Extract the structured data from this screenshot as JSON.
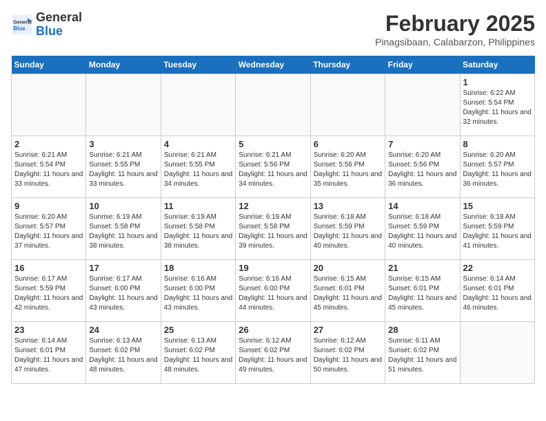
{
  "header": {
    "logo_line1": "General",
    "logo_line2": "Blue",
    "month_title": "February 2025",
    "location": "Pinagsibaan, Calabarzon, Philippines"
  },
  "days_of_week": [
    "Sunday",
    "Monday",
    "Tuesday",
    "Wednesday",
    "Thursday",
    "Friday",
    "Saturday"
  ],
  "weeks": [
    [
      {
        "day": "",
        "info": ""
      },
      {
        "day": "",
        "info": ""
      },
      {
        "day": "",
        "info": ""
      },
      {
        "day": "",
        "info": ""
      },
      {
        "day": "",
        "info": ""
      },
      {
        "day": "",
        "info": ""
      },
      {
        "day": "1",
        "info": "Sunrise: 6:22 AM\nSunset: 5:54 PM\nDaylight: 11 hours and 32 minutes."
      }
    ],
    [
      {
        "day": "2",
        "info": "Sunrise: 6:21 AM\nSunset: 5:54 PM\nDaylight: 11 hours and 33 minutes."
      },
      {
        "day": "3",
        "info": "Sunrise: 6:21 AM\nSunset: 5:55 PM\nDaylight: 11 hours and 33 minutes."
      },
      {
        "day": "4",
        "info": "Sunrise: 6:21 AM\nSunset: 5:55 PM\nDaylight: 11 hours and 34 minutes."
      },
      {
        "day": "5",
        "info": "Sunrise: 6:21 AM\nSunset: 5:56 PM\nDaylight: 11 hours and 34 minutes."
      },
      {
        "day": "6",
        "info": "Sunrise: 6:20 AM\nSunset: 5:56 PM\nDaylight: 11 hours and 35 minutes."
      },
      {
        "day": "7",
        "info": "Sunrise: 6:20 AM\nSunset: 5:56 PM\nDaylight: 11 hours and 36 minutes."
      },
      {
        "day": "8",
        "info": "Sunrise: 6:20 AM\nSunset: 5:57 PM\nDaylight: 11 hours and 36 minutes."
      }
    ],
    [
      {
        "day": "9",
        "info": "Sunrise: 6:20 AM\nSunset: 5:57 PM\nDaylight: 11 hours and 37 minutes."
      },
      {
        "day": "10",
        "info": "Sunrise: 6:19 AM\nSunset: 5:58 PM\nDaylight: 11 hours and 38 minutes."
      },
      {
        "day": "11",
        "info": "Sunrise: 6:19 AM\nSunset: 5:58 PM\nDaylight: 11 hours and 38 minutes."
      },
      {
        "day": "12",
        "info": "Sunrise: 6:19 AM\nSunset: 5:58 PM\nDaylight: 11 hours and 39 minutes."
      },
      {
        "day": "13",
        "info": "Sunrise: 6:18 AM\nSunset: 5:59 PM\nDaylight: 11 hours and 40 minutes."
      },
      {
        "day": "14",
        "info": "Sunrise: 6:18 AM\nSunset: 5:59 PM\nDaylight: 11 hours and 40 minutes."
      },
      {
        "day": "15",
        "info": "Sunrise: 6:18 AM\nSunset: 5:59 PM\nDaylight: 11 hours and 41 minutes."
      }
    ],
    [
      {
        "day": "16",
        "info": "Sunrise: 6:17 AM\nSunset: 5:59 PM\nDaylight: 11 hours and 42 minutes."
      },
      {
        "day": "17",
        "info": "Sunrise: 6:17 AM\nSunset: 6:00 PM\nDaylight: 11 hours and 43 minutes."
      },
      {
        "day": "18",
        "info": "Sunrise: 6:16 AM\nSunset: 6:00 PM\nDaylight: 11 hours and 43 minutes."
      },
      {
        "day": "19",
        "info": "Sunrise: 6:16 AM\nSunset: 6:00 PM\nDaylight: 11 hours and 44 minutes."
      },
      {
        "day": "20",
        "info": "Sunrise: 6:15 AM\nSunset: 6:01 PM\nDaylight: 11 hours and 45 minutes."
      },
      {
        "day": "21",
        "info": "Sunrise: 6:15 AM\nSunset: 6:01 PM\nDaylight: 11 hours and 45 minutes."
      },
      {
        "day": "22",
        "info": "Sunrise: 6:14 AM\nSunset: 6:01 PM\nDaylight: 11 hours and 46 minutes."
      }
    ],
    [
      {
        "day": "23",
        "info": "Sunrise: 6:14 AM\nSunset: 6:01 PM\nDaylight: 11 hours and 47 minutes."
      },
      {
        "day": "24",
        "info": "Sunrise: 6:13 AM\nSunset: 6:02 PM\nDaylight: 11 hours and 48 minutes."
      },
      {
        "day": "25",
        "info": "Sunrise: 6:13 AM\nSunset: 6:02 PM\nDaylight: 11 hours and 48 minutes."
      },
      {
        "day": "26",
        "info": "Sunrise: 6:12 AM\nSunset: 6:02 PM\nDaylight: 11 hours and 49 minutes."
      },
      {
        "day": "27",
        "info": "Sunrise: 6:12 AM\nSunset: 6:02 PM\nDaylight: 11 hours and 50 minutes."
      },
      {
        "day": "28",
        "info": "Sunrise: 6:11 AM\nSunset: 6:02 PM\nDaylight: 11 hours and 51 minutes."
      },
      {
        "day": "",
        "info": ""
      }
    ]
  ]
}
